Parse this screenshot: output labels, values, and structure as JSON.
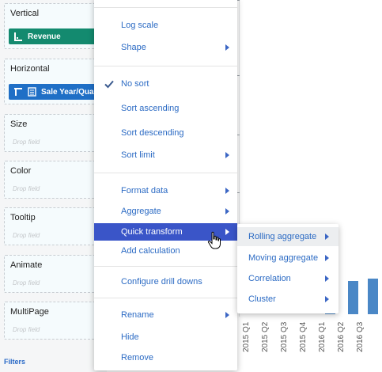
{
  "shelves": {
    "vertical": {
      "label": "Vertical",
      "pill": "Revenue",
      "pill_color": "#138a6f"
    },
    "horizontal": {
      "label": "Horizontal",
      "pill": "Sale Year/Qua",
      "pill_color": "#1f6fc6"
    },
    "size": {
      "label": "Size",
      "drop": "Drop field"
    },
    "color": {
      "label": "Color",
      "drop": "Drop field"
    },
    "tooltip": {
      "label": "Tooltip",
      "drop": "Drop field"
    },
    "animate": {
      "label": "Animate",
      "drop": "Drop field"
    },
    "multipage": {
      "label": "MultiPage",
      "drop": "Drop field"
    },
    "filters": "Filters"
  },
  "menu": {
    "log_scale": "Log scale",
    "shape": "Shape",
    "no_sort": "No sort",
    "sort_ascending": "Sort ascending",
    "sort_descending": "Sort descending",
    "sort_limit": "Sort limit",
    "format_data": "Format data",
    "aggregate": "Aggregate",
    "quick_transform": "Quick transform",
    "add_calculation": "Add calculation",
    "configure_drill_downs": "Configure drill downs",
    "rename": "Rename",
    "hide": "Hide",
    "remove": "Remove",
    "accent_color": "#3a55c8"
  },
  "submenu": {
    "rolling_aggregate": "Rolling aggregate",
    "moving_aggregate": "Moving aggregate",
    "correlation": "Correlation",
    "cluster": "Cluster"
  },
  "chart": {
    "bar_color": "#4a87c6",
    "bar_values": [
      0.38,
      0.42,
      0.45
    ],
    "x_labels": [
      "2015 Q1",
      "2015 Q2",
      "2015 Q3",
      "2015 Q4",
      "2016 Q1",
      "2016 Q2",
      "2016 Q3"
    ]
  }
}
